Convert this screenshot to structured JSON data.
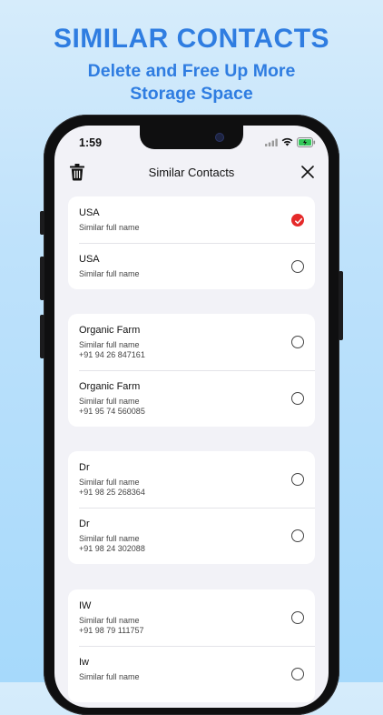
{
  "headline": "SIMILAR CONTACTS",
  "subline": [
    "Delete and Free Up More",
    "Storage Space"
  ],
  "status_bar": {
    "time": "1:59"
  },
  "nav": {
    "title": "Similar Contacts",
    "left_icon": "trash-icon",
    "right_icon": "close-icon"
  },
  "colors": {
    "accent": "#2f7de1",
    "selected": "#e52a2a",
    "screen_bg": "#f2f2f7"
  },
  "groups": [
    {
      "contacts": [
        {
          "name": "USA",
          "label": "Similar full name",
          "phone": "",
          "selected": true
        },
        {
          "name": "USA",
          "label": "Similar full name",
          "phone": "",
          "selected": false
        }
      ]
    },
    {
      "contacts": [
        {
          "name": "Organic Farm",
          "label": "Similar full name",
          "phone": "+91 94 26 847161",
          "selected": false
        },
        {
          "name": "Organic Farm",
          "label": "Similar full name",
          "phone": "+91 95 74 560085",
          "selected": false
        }
      ]
    },
    {
      "contacts": [
        {
          "name": "Dr",
          "label": "Similar full name",
          "phone": "+91 98 25 268364",
          "selected": false
        },
        {
          "name": "Dr",
          "label": "Similar full name",
          "phone": "+91 98 24 302088",
          "selected": false
        }
      ]
    },
    {
      "contacts": [
        {
          "name": "IW",
          "label": "Similar full name",
          "phone": "+91 98 79 111757",
          "selected": false
        },
        {
          "name": "Iw",
          "label": "Similar full name",
          "phone": "",
          "selected": false
        }
      ]
    }
  ]
}
